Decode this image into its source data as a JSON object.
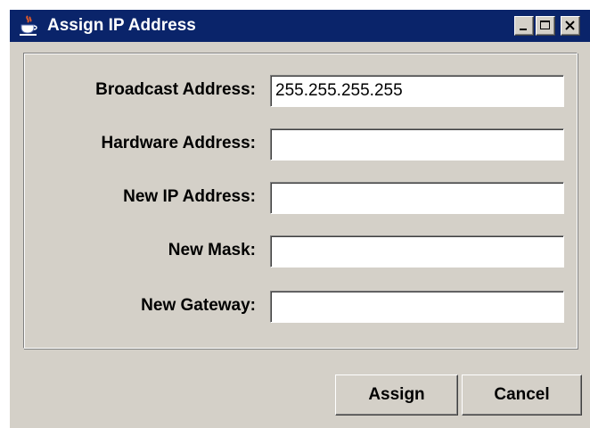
{
  "window": {
    "title": "Assign IP Address",
    "title_bar_color": "#0a246a",
    "background_color": "#d4d0c8",
    "controls": [
      "minimize-icon",
      "maximize-icon",
      "close-icon"
    ]
  },
  "form": {
    "broadcast": {
      "label": "Broadcast Address:",
      "value": "255.255.255.255"
    },
    "hardware": {
      "label": "Hardware Address:",
      "value": ""
    },
    "new_ip": {
      "label": "New IP Address:",
      "value": ""
    },
    "new_mask": {
      "label": "New Mask:",
      "value": ""
    },
    "new_gateway": {
      "label": "New Gateway:",
      "value": ""
    }
  },
  "buttons": {
    "assign_label": "Assign",
    "cancel_label": "Cancel"
  }
}
